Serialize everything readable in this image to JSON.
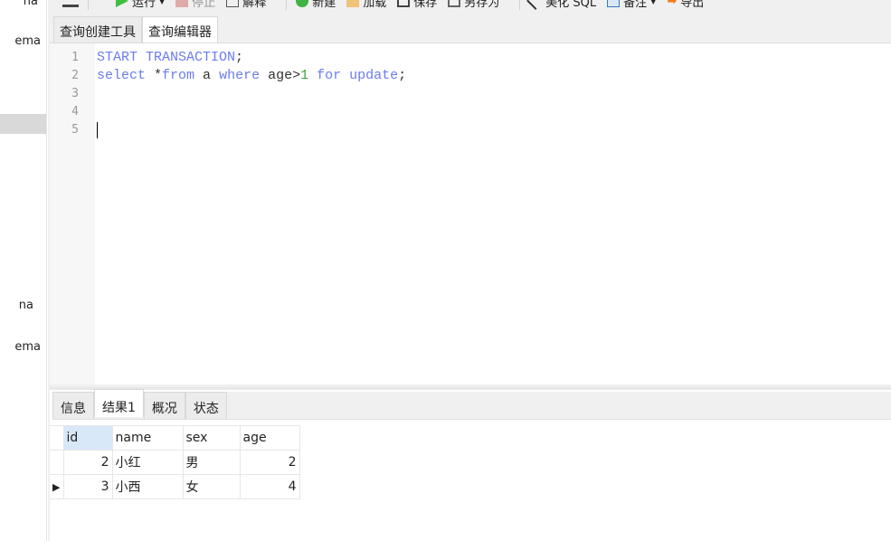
{
  "sidebar": {
    "items": [
      "na",
      "ema",
      "na",
      "ema"
    ]
  },
  "toolbar": {
    "run": "运行",
    "stop": "停止",
    "explain": "解释",
    "new": "新建",
    "load": "加载",
    "save": "保存",
    "save_as": "另存为",
    "beautify": "美化 SQL",
    "comment": "备注",
    "export": "导出"
  },
  "query_tabs": [
    "查询创建工具",
    "查询编辑器"
  ],
  "editor": {
    "line_numbers": [
      "1",
      "2",
      "3",
      "4",
      "5"
    ],
    "line1": {
      "a": "START TRANSACTION",
      "b": ";"
    },
    "line2": {
      "select": "select",
      "star": " *",
      "from": "from",
      "a": " a ",
      "where": "where",
      "age": " age>",
      "num": "1",
      "for": " for",
      "update": " update",
      "semi": ";"
    }
  },
  "result_tabs": [
    "信息",
    "结果1",
    "概况",
    "状态"
  ],
  "grid": {
    "columns": [
      "id",
      "name",
      "sex",
      "age"
    ],
    "rows": [
      [
        "2",
        "小红",
        "男",
        "2"
      ],
      [
        "3",
        "小西",
        "女",
        "4"
      ]
    ]
  },
  "colors": {
    "keyword": "#6b7cf0",
    "number": "#3aa63a"
  }
}
